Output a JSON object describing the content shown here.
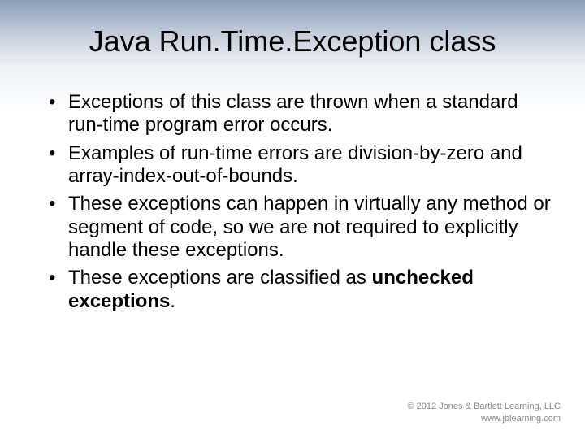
{
  "title": "Java Run.Time.Exception class",
  "bullets": [
    {
      "text": "Exceptions of this class are thrown when a standard run-time program error occurs."
    },
    {
      "text": "Examples of run-time errors are division-by-zero and array-index-out-of-bounds."
    },
    {
      "text": "These exceptions can happen in virtually any method or segment of code, so we are not required to explicitly handle these exceptions."
    },
    {
      "prefix": "These exceptions are classified as ",
      "bold": "unchecked exceptions",
      "suffix": "."
    }
  ],
  "footer": {
    "line1": "© 2012 Jones & Bartlett Learning, LLC",
    "line2": "www.jblearning.com"
  }
}
